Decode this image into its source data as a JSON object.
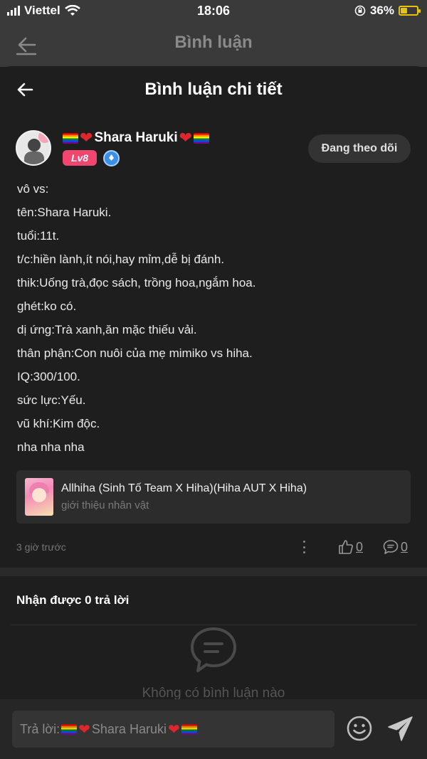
{
  "status_bar": {
    "carrier": "Viettel",
    "time": "18:06",
    "battery_percent": "36%"
  },
  "background_header": {
    "title": "Bình luận"
  },
  "sheet": {
    "title": "Bình luận chi tiết"
  },
  "comment": {
    "username": "Shara Haruki",
    "level": "Lv8",
    "follow_label": "Đang theo dõi",
    "lines": [
      "vô vs:",
      "tên:Shara Haruki.",
      "tuổi:11t.",
      "t/c:hiền lành,ít nói,hay mỉm,dễ bị đánh.",
      "thik:Uống trà,đọc sách, trồng hoa,ngắm hoa.",
      "ghét:ko có.",
      "dị ứng:Trà xanh,ăn mặc thiếu vải.",
      "thân phận:Con nuôi của mẹ mimiko vs hiha.",
      "IQ:300/100.",
      "sức lực:Yếu.",
      "vũ khí:Kim độc.",
      "nha nha nha"
    ],
    "linked_story": {
      "title": "Allhiha (Sinh Tố Team X Hiha)(Hiha AUT X Hiha)",
      "subtitle": "giới thiệu nhân vật"
    },
    "timestamp": "3 giờ trước",
    "like_count": "0",
    "reply_count": "0"
  },
  "replies": {
    "heading": "Nhận được 0 trả lời",
    "empty_text": "Không có bình luận nào"
  },
  "reply_input": {
    "prefix": "Trả lời: ",
    "target_name": "Shara Haruki"
  },
  "colors": {
    "background": "#1e1e1e",
    "card": "#2c2c2c",
    "level_badge": "#f1476e",
    "heart": "#e0262b"
  }
}
